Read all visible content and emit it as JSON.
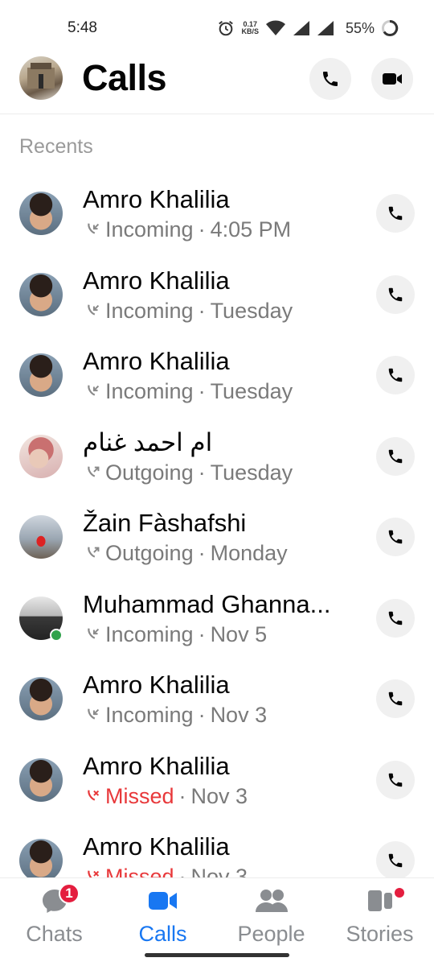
{
  "status_bar": {
    "time": "5:48",
    "speed_value": "0.17",
    "speed_unit": "KB/S",
    "battery": "55%"
  },
  "header": {
    "title": "Calls",
    "audio_call_icon": "phone-icon",
    "video_call_icon": "video-camera-icon"
  },
  "section_label": "Recents",
  "calls": [
    {
      "name": "Amro Khalilia",
      "type": "Incoming",
      "time": "4:05 PM",
      "missed": false
    },
    {
      "name": "Amro Khalilia",
      "type": "Incoming",
      "time": "Tuesday",
      "missed": false
    },
    {
      "name": "Amro Khalilia",
      "type": "Incoming",
      "time": "Tuesday",
      "missed": false
    },
    {
      "name": "ام احمد غنام",
      "type": "Outgoing",
      "time": "Tuesday",
      "missed": false
    },
    {
      "name": "Žain Fàshafshi",
      "type": "Outgoing",
      "time": "Monday",
      "missed": false
    },
    {
      "name": "Muhammad Ghanna...",
      "type": "Incoming",
      "time": "Nov 5",
      "missed": false,
      "online": true
    },
    {
      "name": "Amro Khalilia",
      "type": "Incoming",
      "time": "Nov 3",
      "missed": false
    },
    {
      "name": "Amro Khalilia",
      "type": "Missed",
      "time": "Nov 3",
      "missed": true
    },
    {
      "name": "Amro Khalilia",
      "type": "Missed",
      "time": "Nov 3",
      "missed": true
    }
  ],
  "separator": "·",
  "nav": {
    "chats": {
      "label": "Chats",
      "badge": "1"
    },
    "calls": {
      "label": "Calls"
    },
    "people": {
      "label": "People"
    },
    "stories": {
      "label": "Stories"
    }
  },
  "colors": {
    "accent": "#1877f2",
    "missed": "#e8383a",
    "badge": "#e41e3f",
    "online": "#31a24c"
  }
}
